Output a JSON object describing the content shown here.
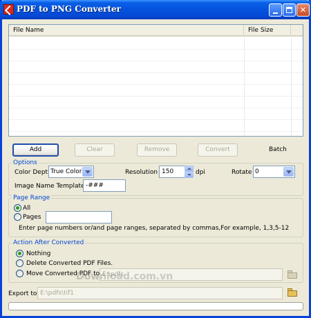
{
  "window": {
    "title": "PDF to PNG Converter",
    "accent_color": "#0553DE",
    "controls": [
      "minimize-icon",
      "maximize-icon",
      "close-icon"
    ],
    "close_glyph": "✕"
  },
  "file_list": {
    "columns": [
      "File Name",
      "File Size"
    ],
    "rows": []
  },
  "toolbar": {
    "add_label": "Add",
    "clear_label": "Clear",
    "remove_label": "Remove",
    "convert_label": "Convert",
    "batch_label": "Batch"
  },
  "options": {
    "legend": "Options",
    "color_depth_label": "Color Depth",
    "color_depth_value": "True Colors",
    "resolution_label": "Resolution",
    "resolution_value": "150",
    "resolution_unit": "dpi",
    "rotate_label": "Rotate",
    "rotate_value": "0",
    "image_name_template_label": "Image Name Template",
    "image_name_template_value": "-###"
  },
  "page_range": {
    "legend": "Page Range",
    "all_label": "All",
    "all_checked": true,
    "pages_label": "Pages",
    "pages_value": "",
    "hint": "Enter page numbers or/and page ranges, separated by commas,For example, 1,3,5-12"
  },
  "after_converted": {
    "legend": "Action After Converted",
    "nothing_label": "Nothing",
    "delete_label": "Delete Converted PDF Files.",
    "move_label": "Move Converted PDF to",
    "move_path": "E:\\pdfs",
    "selected": "Nothing"
  },
  "export": {
    "label": "Export to",
    "path": "E:\\pdfs\\tif1"
  },
  "watermark": "Download.com.vn",
  "progress": 0
}
